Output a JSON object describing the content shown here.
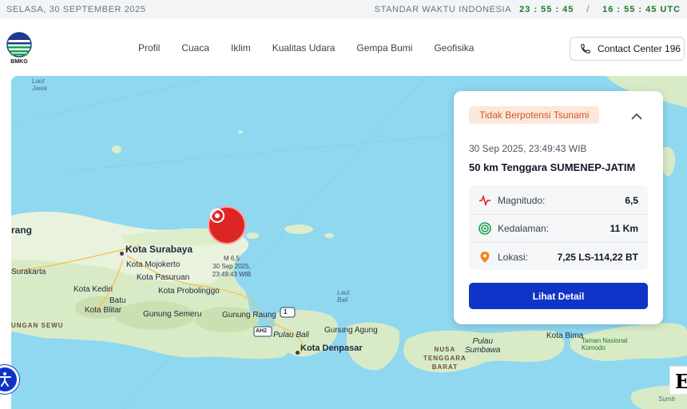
{
  "topbar": {
    "date": "SELASA, 30 SEPTEMBER 2025",
    "standard_label": "STANDAR WAKTU INDONESIA",
    "local_time": "23 : 55 : 45",
    "separator": "/",
    "utc_time": "16 : 55 : 45 UTC"
  },
  "brand": {
    "logo_text": "BMKG"
  },
  "menu": {
    "items": [
      "Profil",
      "Cuaca",
      "Iklim",
      "Kualitas Udara",
      "Gempa Bumi",
      "Geofisika"
    ]
  },
  "contact": {
    "label": "Contact Center 196",
    "icon": "phone-icon"
  },
  "map": {
    "labels": {
      "laut_jawa": "Laut\nJawa",
      "surabaya": "Kota Surabaya",
      "mojokerto": "Kota Mojokerto",
      "pasuruan": "Kota Pasuruan",
      "kediri": "Kota Kediri",
      "probolinggo": "Kota Probolinggo",
      "batu": "Batu",
      "blitar": "Kota Blitar",
      "semeru": "Gunung Semeru",
      "raung": "Gunung Raung",
      "agung": "Gunung Agung",
      "pulau_bali": "Pulau Bali",
      "denpasar": "Kota Denpasar",
      "laut_bali": "Laut\nBali",
      "nusa_tenggara_barat": "NUSA\nTENGGARA\nBARAT",
      "pulau_sumbawa": "Pulau\nSumbawa",
      "bima": "Kota Bima",
      "komodo": "Taman Nasional\nKomodo",
      "gunung_sewu": "UNGAN SEWU",
      "surakarta": "Surakarta",
      "rang": "rang",
      "ah2": "AH2",
      "route1": "1",
      "edge_right": "Sumb"
    },
    "epicenter": {
      "magnitude_label": "M 6,5",
      "date": "30 Sep 2025,",
      "time": "23:49:43 WIB",
      "color": "#dc2626"
    }
  },
  "card": {
    "badge": "Tidak Berpotensi Tsunami",
    "datetime": "30 Sep 2025, 23:49:43 WIB",
    "location": "50 km Tenggara SUMENEP-JATIM",
    "rows": [
      {
        "label": "Magnitudo:",
        "value": "6,5",
        "icon": "seismograph-icon"
      },
      {
        "label": "Kedalaman:",
        "value": "11 Km",
        "icon": "target-icon"
      },
      {
        "label": "Lokasi:",
        "value": "7,25 LS-114,22 BT",
        "icon": "location-pin-icon"
      }
    ],
    "button": "Lihat Detail",
    "accent": "#0f34c7"
  },
  "overlay": {
    "e_letter": "E"
  }
}
